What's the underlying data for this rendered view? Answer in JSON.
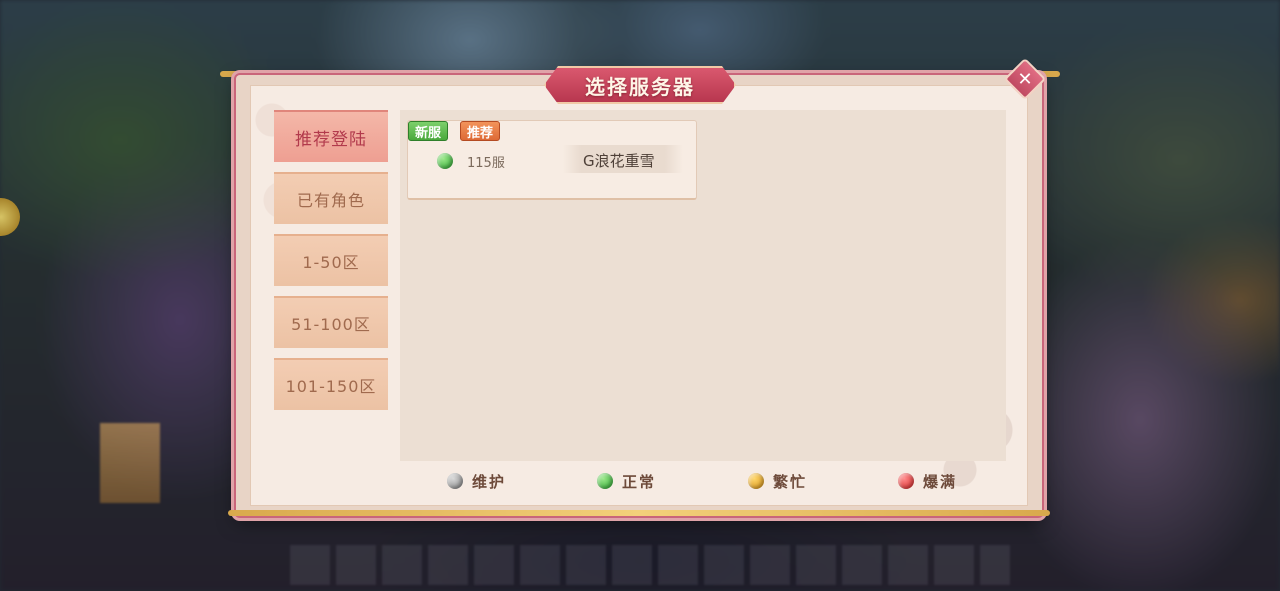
{
  "dialog": {
    "title": "选择服务器",
    "close_icon": "close-icon"
  },
  "tabs": [
    {
      "label": "推荐登陆",
      "active": true
    },
    {
      "label": "已有角色",
      "active": false
    },
    {
      "label": "1-50区",
      "active": false
    },
    {
      "label": "51-100区",
      "active": false
    },
    {
      "label": "101-150区",
      "active": false
    }
  ],
  "servers": [
    {
      "tags": [
        "新服",
        "推荐"
      ],
      "status": "正常",
      "number": "115服",
      "name": "G浪花重雪"
    }
  ],
  "legend": [
    {
      "label": "维护",
      "color": "#8a8a8a"
    },
    {
      "label": "正常",
      "color": "#2aa52e"
    },
    {
      "label": "繁忙",
      "color": "#d8921a"
    },
    {
      "label": "爆满",
      "color": "#d42a2a"
    }
  ],
  "colors": {
    "accent": "#c9455e",
    "panel": "#f6ebe3"
  }
}
